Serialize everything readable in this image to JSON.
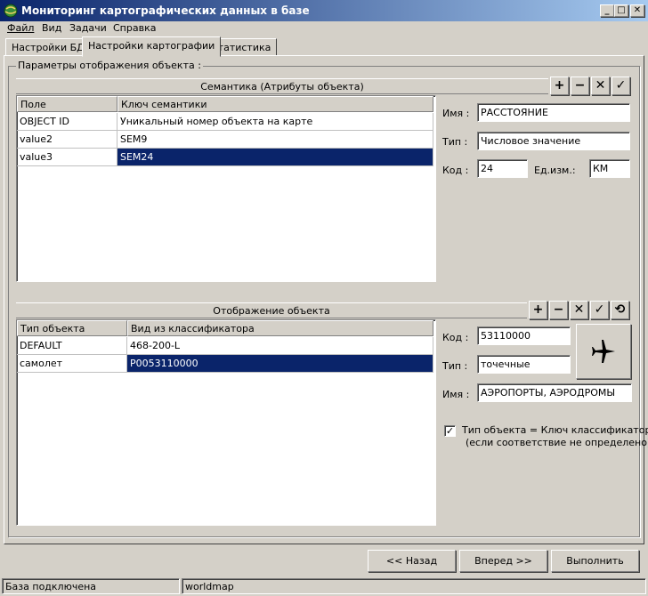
{
  "window": {
    "title": "Мониторинг картографических данных в базе",
    "controls": [
      "_",
      "□",
      "✕"
    ]
  },
  "menu": [
    "Файл",
    "Вид",
    "Задачи",
    "Справка"
  ],
  "tabs": [
    "Настройки БД",
    "Настройки картографии",
    "Статистика"
  ],
  "active_tab": 1,
  "group": {
    "title": "Параметры отображения объекта :"
  },
  "semantics": {
    "title": "Семантика (Атрибуты объекта)",
    "toolbar": [
      "+",
      "−",
      "✕",
      "✓"
    ],
    "columns": [
      "Поле",
      "Ключ семантики"
    ],
    "rows": [
      [
        "OBJECT ID",
        "Уникальный номер объекта на карте"
      ],
      [
        "value2",
        "SEM9"
      ],
      [
        "value3",
        "SEM24"
      ]
    ],
    "selected_row": 2,
    "name_label": "Имя :",
    "name_value": "РАССТОЯНИЕ",
    "type_label": "Тип :",
    "type_value": "Числовое значение",
    "code_label": "Код :",
    "code_value": "24",
    "unit_label": "Ед.изм.:",
    "unit_value": "КМ"
  },
  "display": {
    "title": "Отображение объекта",
    "toolbar": [
      "+",
      "−",
      "✕",
      "✓",
      "⟲"
    ],
    "columns": [
      "Тип объекта",
      "Вид из классификатора"
    ],
    "rows": [
      [
        "DEFAULT",
        "468-200-L"
      ],
      [
        "самолет",
        "P0053110000"
      ]
    ],
    "selected_row": 1,
    "code_label": "Код :",
    "code_value": "53110000",
    "type_label": "Тип :",
    "type_value": "точечные",
    "name_label": "Имя :",
    "name_value": "АЭРОПОРТЫ, АЭРОДРОМЫ",
    "preview_icon": "airplane-icon",
    "checkbox_checked": true,
    "checkbox_line1": "Тип объекта = Ключ классификатора",
    "checkbox_line2": "(если соответствие не определено)"
  },
  "buttons": {
    "back": "<< Назад",
    "next": "Вперед >>",
    "run": "Выполнить"
  },
  "status": {
    "left": "База подключена",
    "right": "worldmap"
  }
}
